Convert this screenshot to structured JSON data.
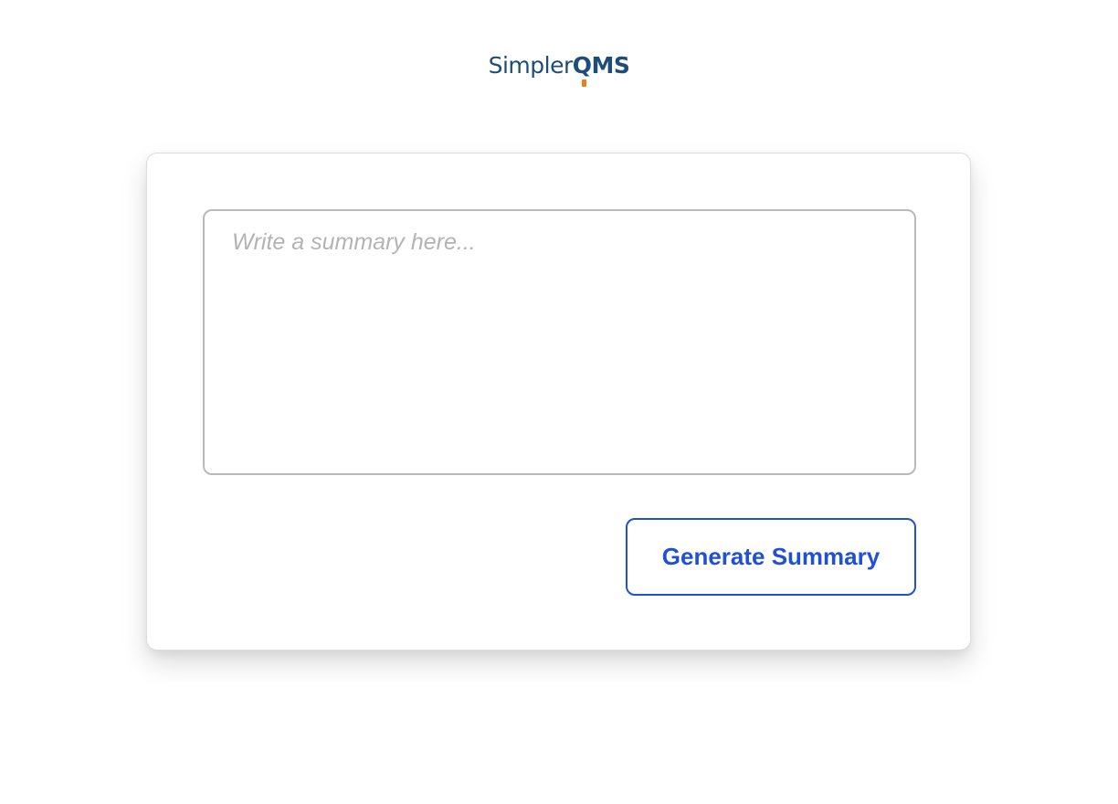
{
  "brand": {
    "logo_light": "Simpler",
    "logo_q": "Q",
    "logo_bold_rest": "MS",
    "primary_color": "#1e4d78",
    "accent_color": "#ef7d1a"
  },
  "editor": {
    "value": "",
    "placeholder": "Write a summary here..."
  },
  "actions": {
    "generate_label": "Generate Summary",
    "button_color": "#1f50d6"
  }
}
